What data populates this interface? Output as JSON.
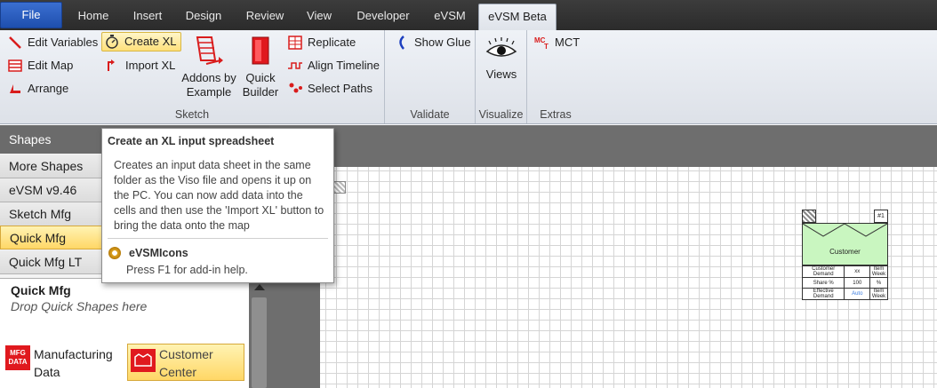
{
  "tabs": [
    "File",
    "Home",
    "Insert",
    "Design",
    "Review",
    "View",
    "Developer",
    "eVSM",
    "eVSM Beta"
  ],
  "ribbon": {
    "sketch": {
      "edit_variables": "Edit Variables",
      "create_xl": "Create XL",
      "edit_map": "Edit Map",
      "import_xl": "Import XL",
      "arrange": "Arrange",
      "addons_line1": "Addons by",
      "addons_line2": "Example",
      "quick_line1": "Quick",
      "quick_line2": "Builder",
      "replicate": "Replicate",
      "align_timeline": "Align Timeline",
      "select_paths": "Select Paths",
      "label": "Sketch"
    },
    "validate": {
      "show_glue": "Show Glue",
      "label": "Validate"
    },
    "visualize": {
      "views": "Views",
      "label": "Visualize"
    },
    "extras": {
      "mct": "MCT",
      "label": "Extras"
    }
  },
  "shapes_pane": {
    "title": "Shapes",
    "stencils": [
      "More Shapes",
      "eVSM v9.46",
      "Sketch Mfg",
      "Quick Mfg",
      "Quick Mfg LT"
    ],
    "active_stencil": "Quick Mfg",
    "stencil_title": "Quick Mfg",
    "stencil_hint": "Drop Quick Shapes here",
    "masters": [
      {
        "icon_text_1": "MFG",
        "icon_text_2": "DATA",
        "label_1": "Manufacturing",
        "label_2": "Data"
      },
      {
        "label_1": "Customer",
        "label_2": "Center"
      }
    ]
  },
  "tooltip": {
    "title": "Create an XL input spreadsheet",
    "body": "Creates an input data sheet in the same folder as the Viso file and opens it up on the PC. You can now add data into the cells and then use the 'Import XL' button to bring the data onto the map",
    "addin": "eVSMIcons",
    "help": "Press F1 for add-in help."
  },
  "customer_shape": {
    "corner_label": "#1",
    "name": "Customer",
    "rows": [
      {
        "label": "Customer Demand",
        "value": "xx",
        "unit": "Item Week"
      },
      {
        "label": "Share %",
        "value": "100",
        "unit": "%"
      },
      {
        "label": "Effective Demand",
        "value": "Auto",
        "unit": "Item Week"
      }
    ]
  },
  "colors": {
    "accent_file": "#2456c0",
    "highlight": "#ffd766",
    "canvas_grid": "#d5d5d5",
    "customer_fill": "#c9f6c0",
    "auto_value": "#3b7de0"
  }
}
